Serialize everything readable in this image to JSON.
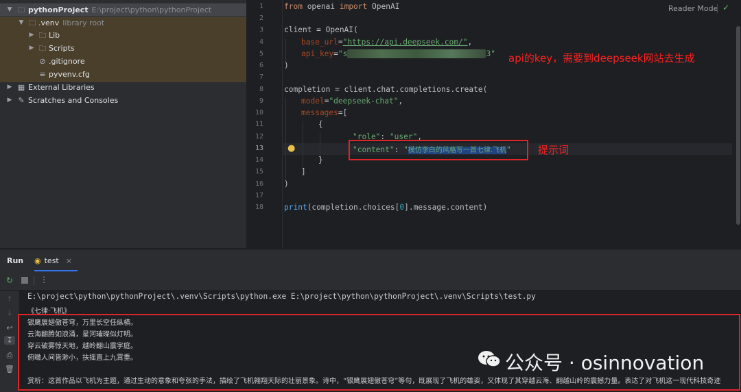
{
  "project": {
    "root_name": "pythonProject",
    "root_path": "E:\\project\\python\\pythonProject",
    "venv_name": ".venv",
    "venv_note": "library root",
    "items": [
      {
        "label": "Lib",
        "icon": "folder-icon"
      },
      {
        "label": "Scripts",
        "icon": "folder-icon"
      },
      {
        "label": ".gitignore",
        "icon": "ignore-file-icon"
      },
      {
        "label": "pyvenv.cfg",
        "icon": "config-file-icon"
      }
    ],
    "external_libraries": "External Libraries",
    "scratches": "Scratches and Consoles"
  },
  "editor": {
    "reader_mode": "Reader Mode",
    "line_numbers": [
      "1",
      "2",
      "3",
      "4",
      "5",
      "6",
      "7",
      "8",
      "9",
      "10",
      "11",
      "12",
      "13",
      "14",
      "15",
      "16",
      "17",
      "18"
    ],
    "active_line": "13",
    "code": {
      "l1_from": "from",
      "l1_mod": " openai ",
      "l1_import": "import",
      "l1_name": " OpenAI",
      "l3": "client = OpenAI(",
      "l4_param": "base_url",
      "l4_eq": "=",
      "l4_val": "\"https://api.deepseek.com/\"",
      "l4_end": ",",
      "l5_param": "api_key",
      "l5_eq": "=",
      "l5_val_start": "\"s",
      "l5_val_end": "3\"",
      "l6": ")",
      "l8": "completion = client.chat.completions.create(",
      "l9_param": "model",
      "l9_eq": "=",
      "l9_val": "\"deepseek-chat\"",
      "l9_end": ",",
      "l10_param": "messages",
      "l10_rest": "=[",
      "l11": "{",
      "l12_key": "\"role\"",
      "l12_colon": ": ",
      "l12_val": "\"user\"",
      "l12_end": ",",
      "l13_key": "\"content\"",
      "l13_colon": ": ",
      "l13_q1": "\"",
      "l13_val": "模仿李白的风格写一首七律.飞机",
      "l13_q2": "\"",
      "l14": "}",
      "l15": "]",
      "l16": ")",
      "l18_print": "print",
      "l18_a": "(completion.choices[",
      "l18_num": "0",
      "l18_b": "].message.content)"
    },
    "annotation_api": "api的key，需要到deepseek网站去生成",
    "annotation_prompt": "提示词"
  },
  "run": {
    "title": "Run",
    "tab": "test",
    "command": "E:\\project\\python\\pythonProject\\.venv\\Scripts\\python.exe E:\\project\\python\\pythonProject\\.venv\\Scripts\\test.py",
    "output_title": "《七律·飞机》",
    "output_lines": [
      "银鹰展翅傲苍穹，万里长空任纵横。",
      "云海翻腾如浪涌，星河璀璨似灯明。",
      "穿云破雾惊天地，越岭翻山震宇庭。",
      "俯瞰人间皆渺小，扶摇直上九霄重。"
    ],
    "appreciation": "赏析：这首作品以飞机为主题，通过生动的意象和夸张的手法，描绘了飞机翱翔天际的壮丽景象。诗中，“银鹰展翅傲苍穹”等句，既展现了飞机的雄姿，又体现了其穿越云海、翻越山岭的震撼力量。表达了对飞机这一现代科技奇迹"
  },
  "watermark": {
    "text": "公众号 · osinnovation"
  },
  "colors": {
    "annotation_red": "#ff2020",
    "keyword": "#cf8e6d",
    "string": "#6aab73",
    "param": "#aa4926",
    "number": "#2aacb8"
  }
}
